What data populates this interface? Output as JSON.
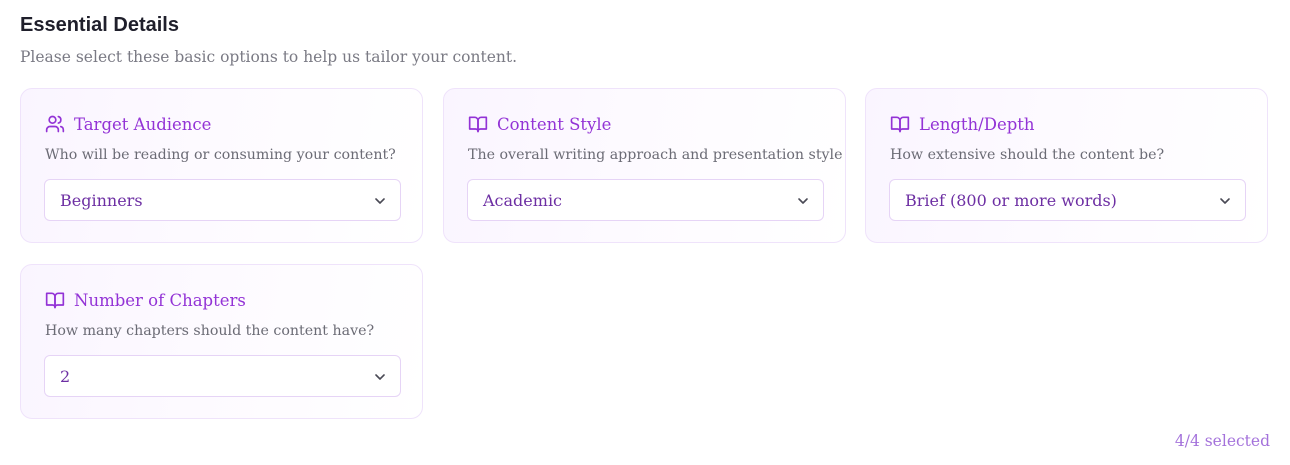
{
  "section": {
    "title": "Essential Details",
    "subtitle": "Please select these basic options to help us tailor your content."
  },
  "cards": [
    {
      "icon": "users-icon",
      "title": "Target Audience",
      "description": "Who will be reading or consuming your content?",
      "selected": "Beginners"
    },
    {
      "icon": "book-open-icon",
      "title": "Content Style",
      "description": "The overall writing approach and presentation style",
      "selected": "Academic"
    },
    {
      "icon": "book-open-icon",
      "title": "Length/Depth",
      "description": "How extensive should the content be?",
      "selected": "Brief (800 or more words)"
    },
    {
      "icon": "book-open-icon",
      "title": "Number of Chapters",
      "description": "How many chapters should the content have?",
      "selected": "2"
    }
  ],
  "footer": {
    "selected_count": "4/4 selected"
  },
  "colors": {
    "accent": "#9333d6",
    "card_border": "#efe3fb",
    "select_text": "#6d2fa3",
    "count_text": "#a472db"
  }
}
